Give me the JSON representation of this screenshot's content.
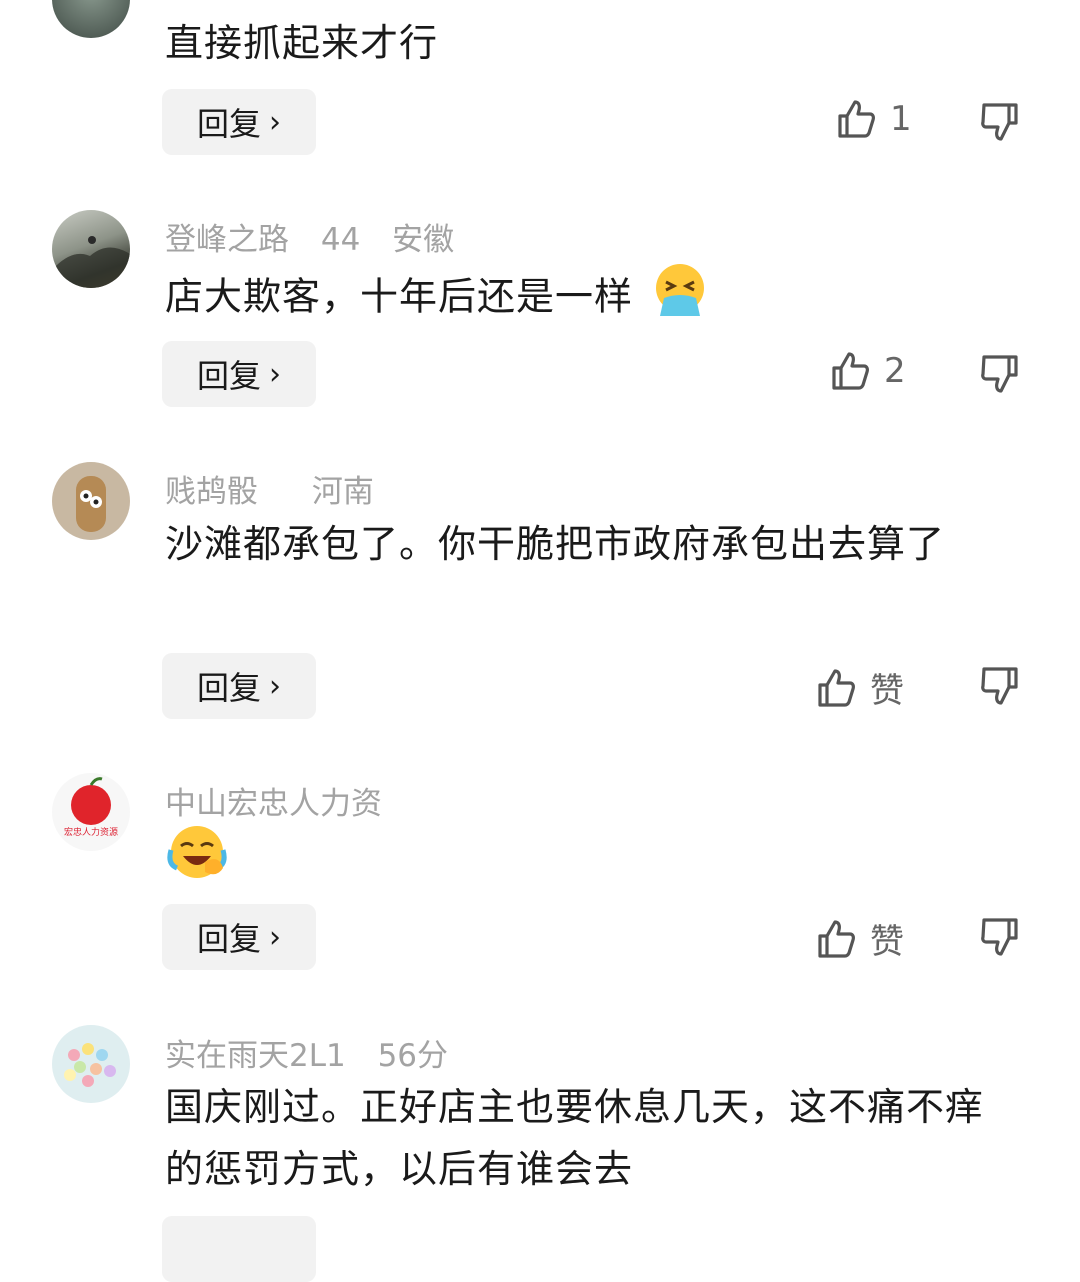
{
  "comments": [
    {
      "user": "",
      "time": "",
      "location": "",
      "text": "直接抓起来才行",
      "reply_label": "回复",
      "like_count": "1"
    },
    {
      "user": "登峰之路",
      "time": "44",
      "location": "安徽",
      "text": "店大欺客，十年后还是一样",
      "reply_label": "回复",
      "like_count": "2"
    },
    {
      "user": "贱鸪骰",
      "time": "",
      "location": "河南",
      "text": "沙滩都承包了。你干脆把市政府承包出去算了",
      "reply_label": "回复",
      "like_count": "赞"
    },
    {
      "user": "中山宏忠人力资",
      "time": "",
      "location": "",
      "avatar_caption": "宏忠人力资源",
      "text": "",
      "reply_label": "回复",
      "like_count": "赞"
    },
    {
      "user": "实在雨天2L1",
      "time": "56分",
      "location": "",
      "text": "国庆刚过。正好店主也要休息几天，这不痛不痒的惩罚方式，以后有谁会去",
      "reply_label": "",
      "like_count": ""
    }
  ],
  "icons": {
    "like": "thumbs-up-icon",
    "dislike": "thumbs-down-icon",
    "chevron": "chevron-right-icon"
  },
  "colors": {
    "meta_text": "#a3a3a3",
    "body_text": "#1a1a1a",
    "button_bg": "#f2f2f2",
    "action_text": "#666666"
  }
}
